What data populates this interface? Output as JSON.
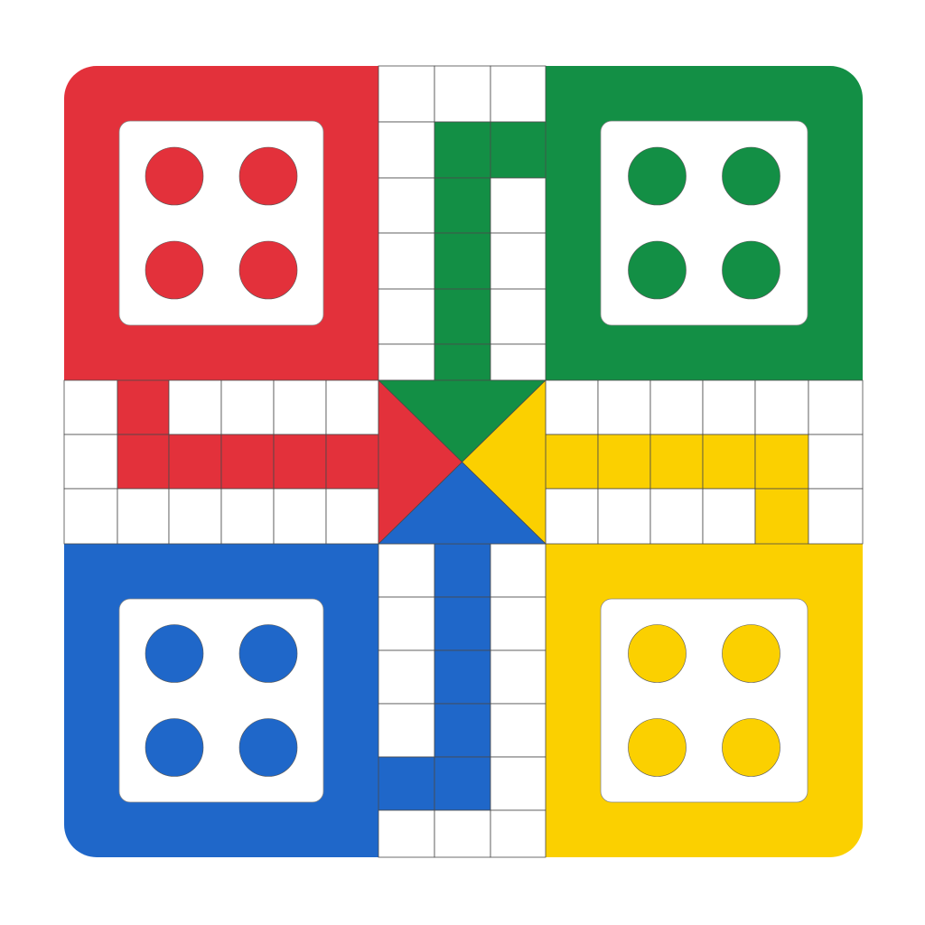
{
  "colors": {
    "red": "#e3313b",
    "green": "#138f45",
    "blue": "#1f67c9",
    "yellow": "#fbd000",
    "white": "#ffffff",
    "line": "#4a4a4a"
  },
  "board": {
    "grid_cells": 15,
    "home_pieces_per_player": 4
  },
  "players": [
    {
      "id": "red",
      "color_key": "red",
      "corner": "top-left",
      "path": "left-arm"
    },
    {
      "id": "green",
      "color_key": "green",
      "corner": "top-right",
      "path": "top-arm"
    },
    {
      "id": "blue",
      "color_key": "blue",
      "corner": "bottom-left",
      "path": "bottom-arm"
    },
    {
      "id": "yellow",
      "color_key": "yellow",
      "corner": "bottom-right",
      "path": "right-arm"
    }
  ],
  "center_triangles": [
    {
      "side": "top",
      "color_key": "green"
    },
    {
      "side": "right",
      "color_key": "yellow"
    },
    {
      "side": "bottom",
      "color_key": "blue"
    },
    {
      "side": "left",
      "color_key": "red"
    }
  ]
}
